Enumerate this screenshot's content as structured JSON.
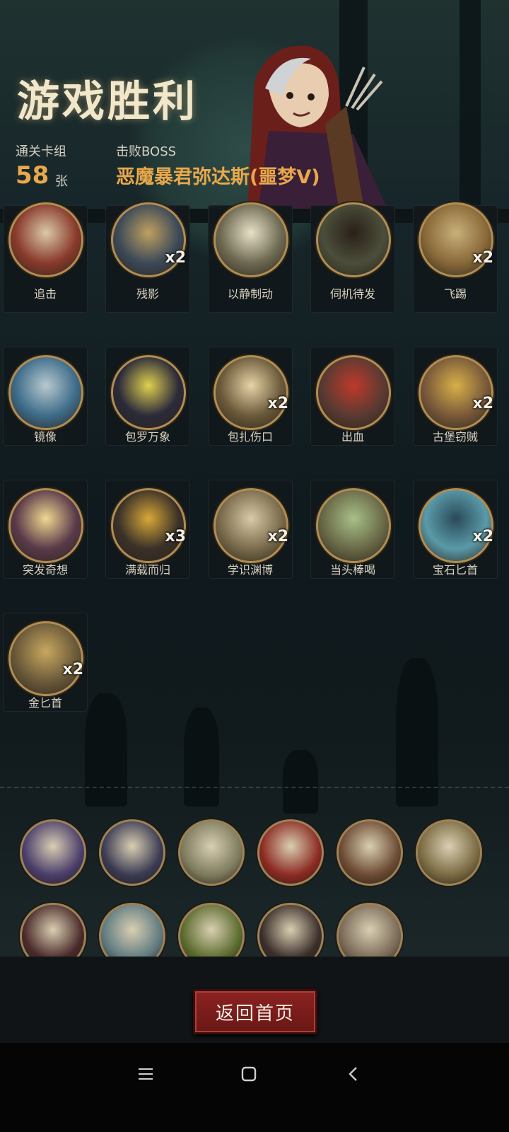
{
  "header": {
    "title": "游戏胜利",
    "deck_label": "通关卡组",
    "deck_count": "58",
    "deck_unit": "张",
    "boss_label": "击败BOSS",
    "boss_name": "恶魔暴君弥达斯(噩梦Ⅴ)"
  },
  "cards": [
    {
      "name": "追击",
      "mult": ""
    },
    {
      "name": "残影",
      "mult": "x2"
    },
    {
      "name": "以静制动",
      "mult": ""
    },
    {
      "name": "伺机待发",
      "mult": ""
    },
    {
      "name": "飞踢",
      "mult": "x2"
    },
    {
      "name": "镜像",
      "mult": ""
    },
    {
      "name": "包罗万象",
      "mult": ""
    },
    {
      "name": "包扎伤口",
      "mult": "x2"
    },
    {
      "name": "出血",
      "mult": ""
    },
    {
      "name": "古堡窃贼",
      "mult": "x2"
    },
    {
      "name": "突发奇想",
      "mult": ""
    },
    {
      "name": "满载而归",
      "mult": "x3"
    },
    {
      "name": "学识渊博",
      "mult": "x2"
    },
    {
      "name": "当头棒喝",
      "mult": ""
    },
    {
      "name": "宝石匕首",
      "mult": "x2"
    },
    {
      "name": "金匕首",
      "mult": "x2"
    }
  ],
  "relics": [
    {
      "icon": "witch-portrait-icon",
      "color": "#4a3d6b"
    },
    {
      "icon": "black-cat-icon",
      "color": "#3a3a52"
    },
    {
      "icon": "magic-lamp-icon",
      "color": "#7d7a5e"
    },
    {
      "icon": "red-shield-icon",
      "color": "#8c2a22"
    },
    {
      "icon": "helmet-warrior-icon",
      "color": "#6b4a32"
    },
    {
      "icon": "deer-icon",
      "color": "#7a6a42"
    },
    {
      "icon": "skull-robot-icon",
      "color": "#4a2a2a"
    },
    {
      "icon": "wind-slash-icon",
      "color": "#5f7a80"
    },
    {
      "icon": "poison-hand-icon",
      "color": "#5b6b2e"
    },
    {
      "icon": "fire-tower-icon",
      "color": "#3a2e2a"
    },
    {
      "icon": "red-hood-girl-icon",
      "color": "#7a6a58"
    }
  ],
  "buttons": {
    "home": "返回首页"
  },
  "navbar": {
    "menu_icon": "menu-icon",
    "home_icon": "home-square-icon",
    "back_icon": "back-chevron-icon"
  }
}
